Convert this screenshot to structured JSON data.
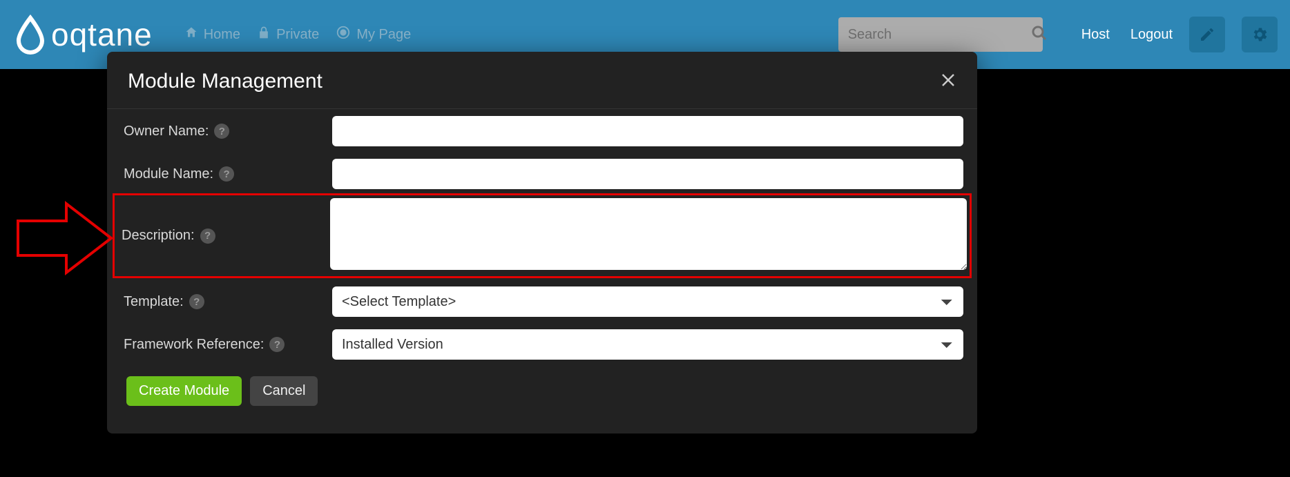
{
  "brand": {
    "name": "oqtane"
  },
  "nav": {
    "items": [
      {
        "label": "Home",
        "icon": "home-icon"
      },
      {
        "label": "Private",
        "icon": "lock-icon"
      },
      {
        "label": "My Page",
        "icon": "target-icon"
      }
    ]
  },
  "search": {
    "placeholder": "Search"
  },
  "user": {
    "host_label": "Host",
    "logout_label": "Logout"
  },
  "modal": {
    "title": "Module Management",
    "fields": {
      "owner_name": {
        "label": "Owner Name:",
        "value": ""
      },
      "module_name": {
        "label": "Module Name:",
        "value": ""
      },
      "description": {
        "label": "Description:",
        "value": ""
      },
      "template": {
        "label": "Template:",
        "selected": "<Select Template>"
      },
      "framework_ref": {
        "label": "Framework Reference:",
        "selected": "Installed Version"
      }
    },
    "buttons": {
      "create": "Create Module",
      "cancel": "Cancel"
    }
  }
}
